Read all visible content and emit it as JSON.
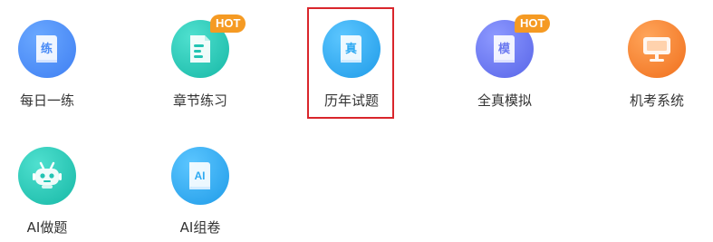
{
  "colors": {
    "badge": "#f59a23",
    "highlight": "#d9262c",
    "label": "#333333"
  },
  "tiles": [
    {
      "label": "每日一练",
      "icon": "practice-book-icon",
      "glyph": "练",
      "badge": "",
      "color": "#4a8cf6",
      "selected": false
    },
    {
      "label": "章节练习",
      "icon": "document-lines-icon",
      "glyph": "",
      "badge": "HOT",
      "color": "#22c4b3",
      "selected": false
    },
    {
      "label": "历年试题",
      "icon": "exam-book-icon",
      "glyph": "真",
      "badge": "",
      "color": "#2eaaf2",
      "selected": true
    },
    {
      "label": "全真模拟",
      "icon": "mock-exam-book-icon",
      "glyph": "模",
      "badge": "HOT",
      "color": "#6a78f0",
      "selected": false
    },
    {
      "label": "机考系统",
      "icon": "monitor-icon",
      "glyph": "",
      "badge": "",
      "color": "#f5832a",
      "selected": false
    },
    {
      "label": "AI做题",
      "icon": "robot-icon",
      "glyph": "",
      "badge": "",
      "color": "#22c4b3",
      "selected": false
    },
    {
      "label": "AI组卷",
      "icon": "ai-book-icon",
      "glyph": "AI",
      "badge": "",
      "color": "#2eaaf2",
      "selected": false
    }
  ]
}
